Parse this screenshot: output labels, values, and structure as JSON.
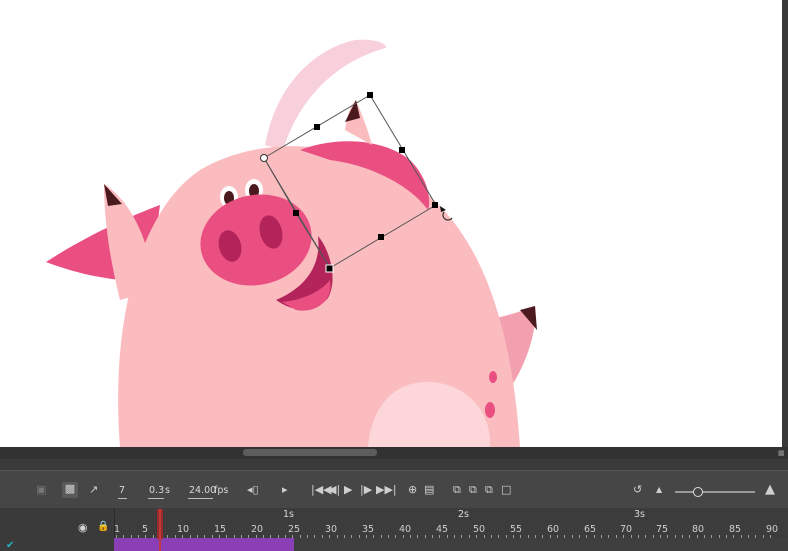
{
  "timeline": {
    "current_frame": "7",
    "elapsed_time": "0.3",
    "elapsed_unit": "s",
    "frame_rate": "24.00",
    "frame_rate_unit": "fps",
    "second_markers": [
      "1s",
      "2s",
      "3s"
    ],
    "frame_numbers": [
      "1",
      "5",
      "10",
      "15",
      "20",
      "25",
      "30",
      "35",
      "40",
      "45",
      "50",
      "55",
      "60",
      "65",
      "70",
      "75",
      "80",
      "85",
      "90"
    ],
    "layer_color": "#8b3fb6",
    "playhead_color": "#a8262a"
  },
  "icons": {
    "camera": "camera-icon",
    "layer_hierarchy": "layer-hierarchy-icon",
    "graph": "graph-icon",
    "eye": "eye-icon",
    "lock": "lock-icon",
    "play": "play-icon",
    "loop": "loop-icon",
    "onion_skin": "onion-skin-icon",
    "zoom": "zoom-slider-icon"
  },
  "stage": {
    "background": "#ffffff",
    "character": "pig",
    "pig_body_color": "#fbbcc0",
    "pig_accent_color": "#f0457c"
  }
}
